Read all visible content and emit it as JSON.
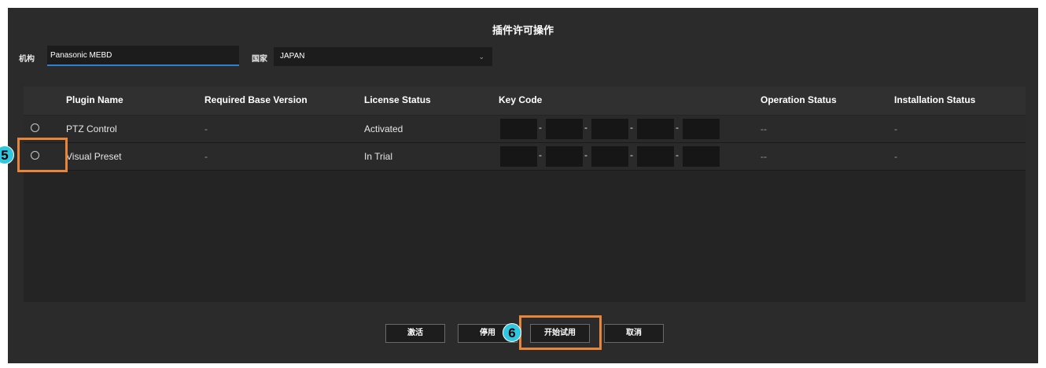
{
  "dialog": {
    "title": "插件许可操作",
    "org_label": "机构",
    "org_value": "Panasonic MEBD",
    "country_label": "国家",
    "country_value": "JAPAN",
    "chevron_icon": "chevron-down-icon"
  },
  "table": {
    "headers": [
      "Plugin Name",
      "Required Base Version",
      "License Status",
      "Key Code",
      "Operation Status",
      "Installation Status"
    ],
    "rows": [
      {
        "name": "PTZ Control",
        "base_version": "-",
        "license_status": "Activated",
        "operation_status": "--",
        "installation_status": "-"
      },
      {
        "name": "Visual Preset",
        "base_version": "-",
        "license_status": "In Trial",
        "operation_status": "--",
        "installation_status": "-"
      }
    ],
    "key_separator": "-"
  },
  "buttons": {
    "activate": "激活",
    "deactivate": "停用",
    "start_trial": "开始试用",
    "cancel": "取消"
  },
  "annotations": {
    "step5": "5",
    "step6": "6",
    "highlight_color": "#e8853a",
    "badge_color": "#2fc6e0"
  }
}
